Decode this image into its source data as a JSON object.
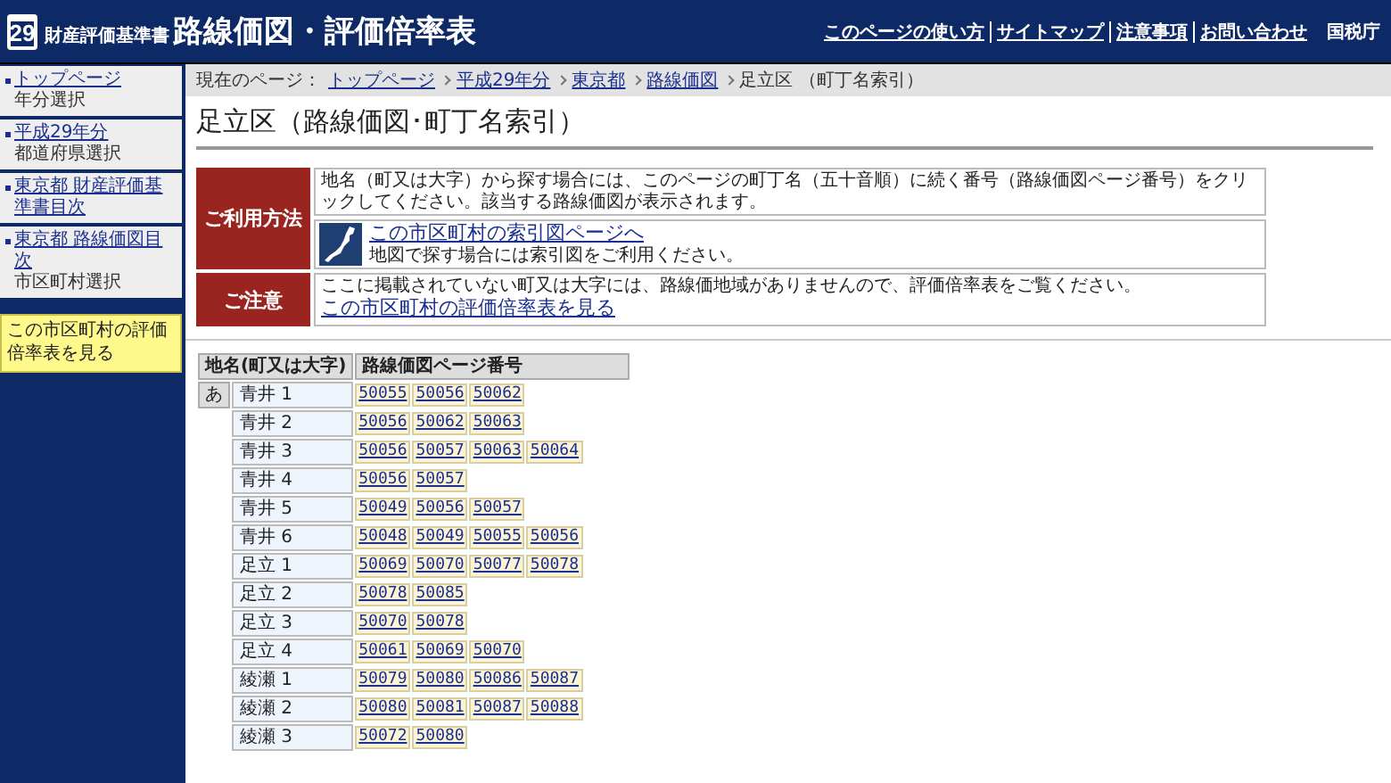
{
  "header": {
    "badge": "29",
    "subtitle": "財産評価基準書",
    "title": "路線価図・評価倍率表",
    "links": [
      "このページの使い方",
      "サイトマップ",
      "注意事項",
      "お問い合わせ"
    ],
    "agency": "国税庁"
  },
  "sidebar": {
    "items": [
      {
        "link": "トップページ",
        "sub": "年分選択"
      },
      {
        "link": "平成29年分",
        "sub": "都道府県選択"
      },
      {
        "link": "東京都 財産評価基準書目次"
      },
      {
        "link": "東京都 路線価図目次",
        "sub": "市区町村選択"
      }
    ],
    "highlight": "この市区町村の評価倍率表を見る"
  },
  "breadcrumb": {
    "label": "現在のページ：",
    "links": [
      "トップページ",
      "平成29年分",
      "東京都",
      "路線価図"
    ],
    "current": "足立区 （町丁名索引）"
  },
  "page_title": "足立区（路線価図･町丁名索引）",
  "usage": {
    "label": "ご利用方法",
    "text": "地名（町又は大字）から探す場合には、このページの町丁名（五十音順）に続く番号（路線価図ページ番号）をクリックしてください。該当する路線価図が表示されます。",
    "index_link": "この市区町村の索引図ページへ",
    "index_note": "地図で探す場合には索引図をご利用ください。"
  },
  "notice": {
    "label": "ご注意",
    "text": "ここに掲載されていない町又は大字には、路線価地域がありませんので、評価倍率表をご覧ください。",
    "link": "この市区町村の評価倍率表を見る"
  },
  "table": {
    "columns": [
      "地名(町又は大字)",
      "路線価図ページ番号"
    ],
    "groups": [
      {
        "kana": "あ",
        "rows": [
          {
            "name": "青井 1",
            "pages": [
              "50055",
              "50056",
              "50062"
            ]
          },
          {
            "name": "青井 2",
            "pages": [
              "50056",
              "50062",
              "50063"
            ]
          },
          {
            "name": "青井 3",
            "pages": [
              "50056",
              "50057",
              "50063",
              "50064"
            ]
          },
          {
            "name": "青井 4",
            "pages": [
              "50056",
              "50057"
            ]
          },
          {
            "name": "青井 5",
            "pages": [
              "50049",
              "50056",
              "50057"
            ]
          },
          {
            "name": "青井 6",
            "pages": [
              "50048",
              "50049",
              "50055",
              "50056"
            ]
          },
          {
            "name": "足立 1",
            "pages": [
              "50069",
              "50070",
              "50077",
              "50078"
            ]
          },
          {
            "name": "足立 2",
            "pages": [
              "50078",
              "50085"
            ]
          },
          {
            "name": "足立 3",
            "pages": [
              "50070",
              "50078"
            ]
          },
          {
            "name": "足立 4",
            "pages": [
              "50061",
              "50069",
              "50070"
            ]
          },
          {
            "name": "綾瀬 1",
            "pages": [
              "50079",
              "50080",
              "50086",
              "50087"
            ]
          },
          {
            "name": "綾瀬 2",
            "pages": [
              "50080",
              "50081",
              "50087",
              "50088"
            ]
          },
          {
            "name": "綾瀬 3",
            "pages": [
              "50072",
              "50080"
            ]
          }
        ]
      }
    ]
  }
}
